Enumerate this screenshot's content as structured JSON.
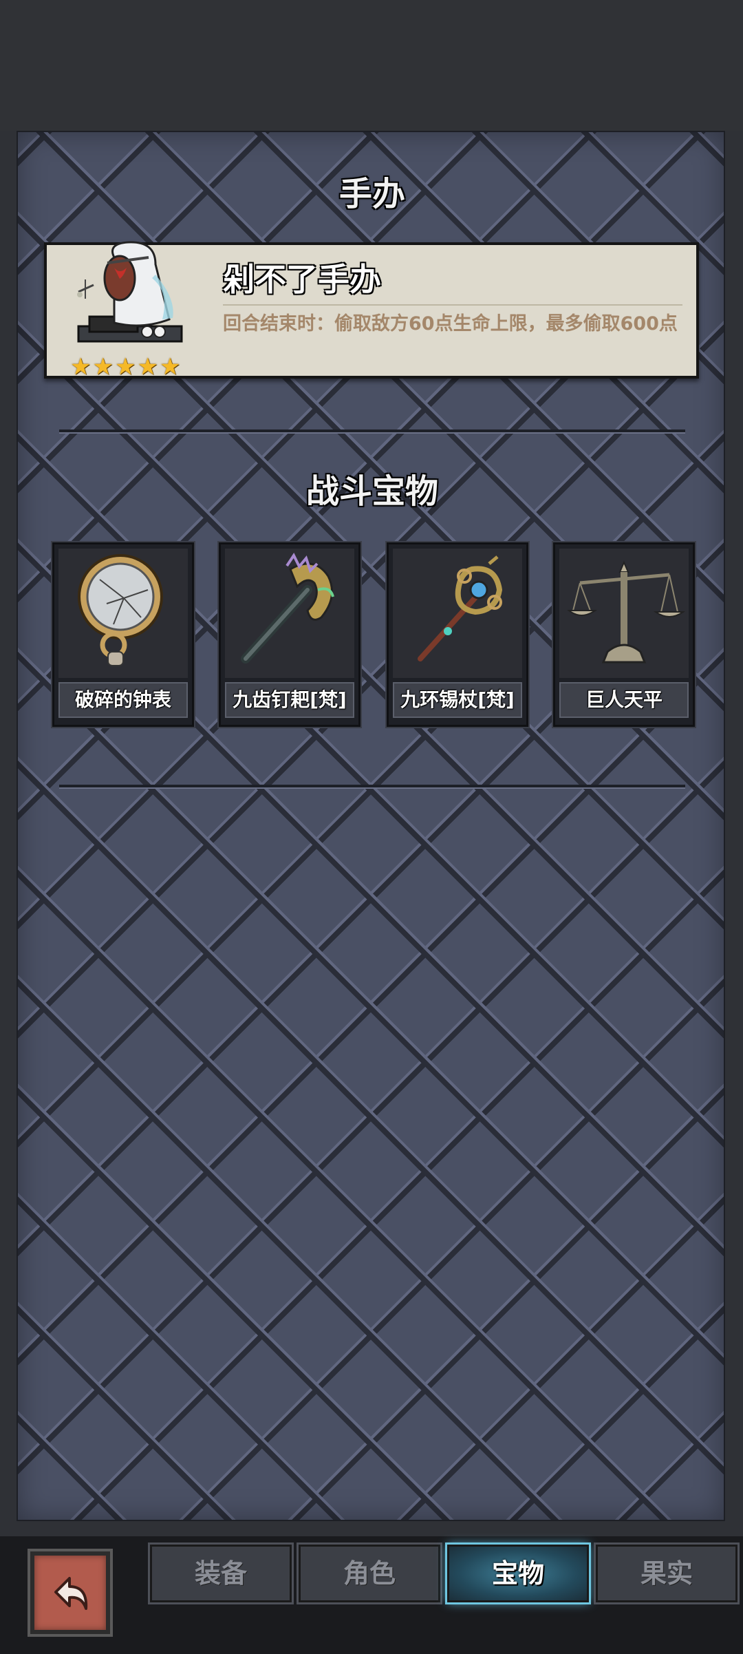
{
  "header": {
    "figure_title": "手办",
    "treasure_title": "战斗宝物"
  },
  "figure": {
    "name": "剁不了手办",
    "description": "回合结束时：偷取敌方60点生命上限，最多偷取600点",
    "stars": 5,
    "star_glyph": "★"
  },
  "treasures": [
    {
      "name": "破碎的钟表",
      "icon": "broken-pocket-watch"
    },
    {
      "name": "九齿钉耙[梵]",
      "icon": "nine-tooth-rake"
    },
    {
      "name": "九环锡杖[梵]",
      "icon": "nine-ring-staff"
    },
    {
      "name": "巨人天平",
      "icon": "giant-balance-scale"
    }
  ],
  "tabs": [
    {
      "label": "装备",
      "active": false
    },
    {
      "label": "角色",
      "active": false
    },
    {
      "label": "宝物",
      "active": true
    },
    {
      "label": "果实",
      "active": false
    }
  ],
  "colors": {
    "accent": "#6fc6e0",
    "star": "#f5b928",
    "back_button": "#b25b4d"
  }
}
